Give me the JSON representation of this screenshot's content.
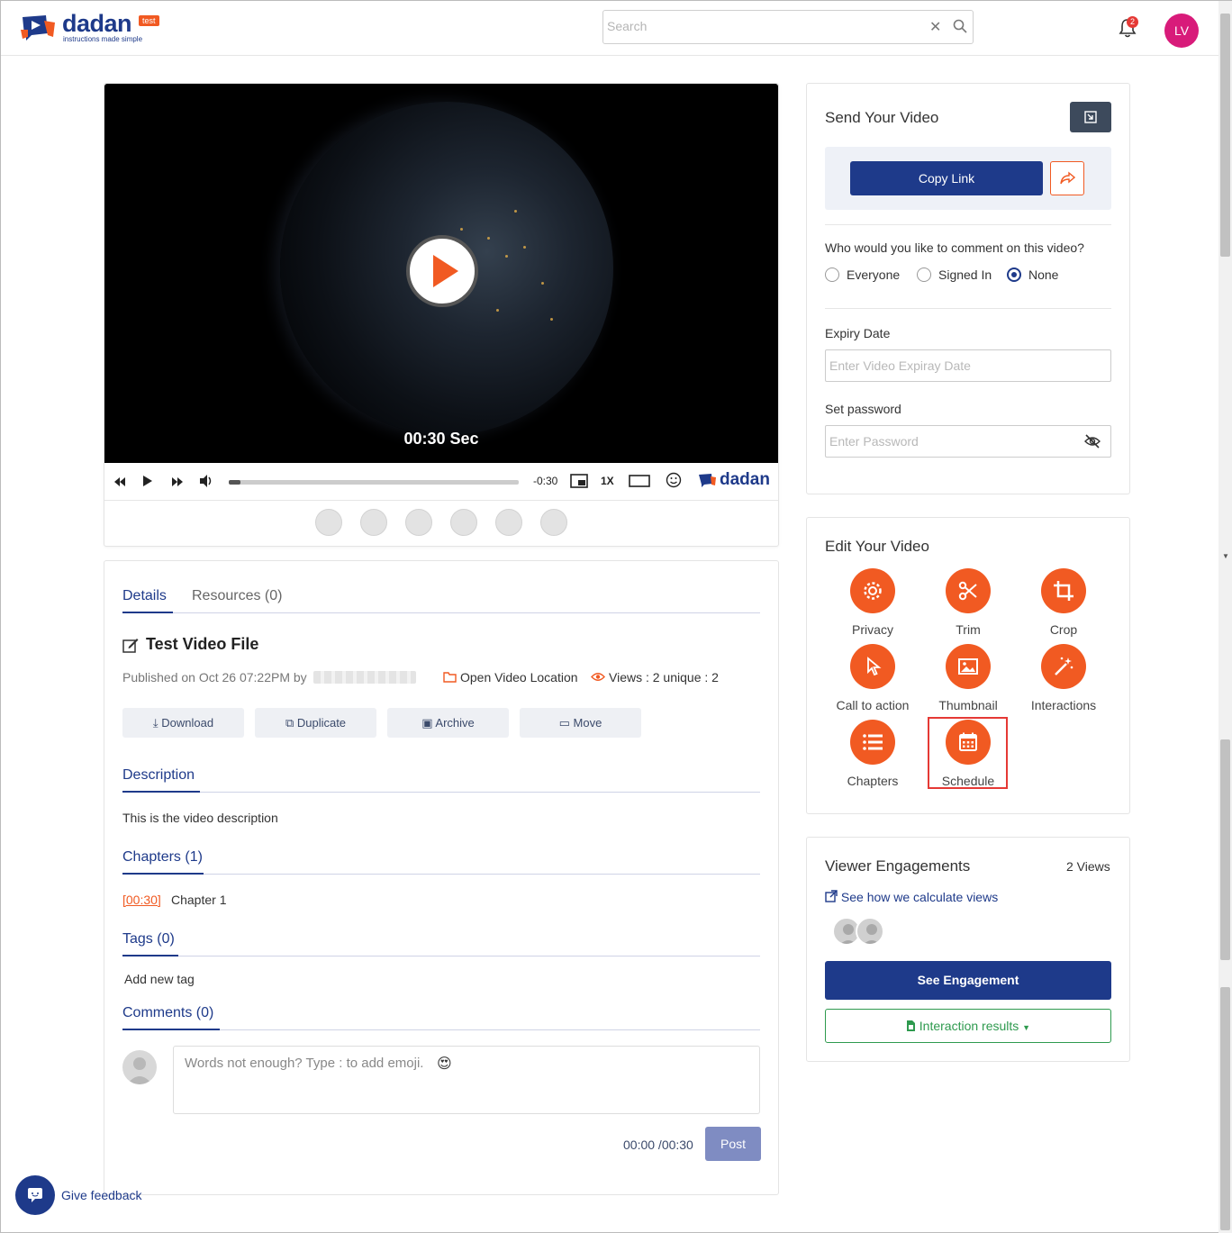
{
  "header": {
    "logo_word": "dadan",
    "logo_badge": "test",
    "logo_tagline": "instructions made simple",
    "search_placeholder": "Search",
    "clear_glyph": "✕",
    "notification_count": "2",
    "user_initials": "LV"
  },
  "player": {
    "overlay_time": "00:30 Sec",
    "remaining": "-0:30",
    "speed": "1X",
    "brand": "dadan",
    "progress_fraction": 0.04
  },
  "details": {
    "tabs": [
      {
        "label": "Details"
      },
      {
        "label": "Resources (0)"
      }
    ],
    "title": "Test Video File",
    "published": "Published on Oct 26 07:22PM by",
    "open_location": "Open Video Location",
    "views": "Views : 2 unique : 2",
    "actions": [
      {
        "label": "Download",
        "icon": "download-icon"
      },
      {
        "label": "Duplicate",
        "icon": "duplicate-icon"
      },
      {
        "label": "Archive",
        "icon": "archive-icon"
      },
      {
        "label": "Move",
        "icon": "folder-icon"
      }
    ],
    "description_heading": "Description",
    "description_text": "This is the video description",
    "chapters_heading": "Chapters (1)",
    "chapter": {
      "time": "[00:30]",
      "name": "Chapter 1"
    },
    "tags_heading": "Tags (0)",
    "add_tag": "Add new tag",
    "comments_heading": "Comments (0)",
    "comment_placeholder": "Words not enough? Type : to add emoji.",
    "comment_time": "00:00 /00:30",
    "post_label": "Post"
  },
  "send": {
    "title": "Send Your Video",
    "copy_link": "Copy Link",
    "comment_question": "Who would you like to comment on this video?",
    "options": [
      {
        "label": "Everyone",
        "selected": false
      },
      {
        "label": "Signed In",
        "selected": false
      },
      {
        "label": "None",
        "selected": true
      }
    ],
    "expiry_label": "Expiry Date",
    "expiry_placeholder": "Enter Video Expiray Date",
    "password_label": "Set password",
    "password_placeholder": "Enter Password"
  },
  "edit": {
    "title": "Edit Your Video",
    "tools": [
      {
        "label": "Privacy",
        "icon": "gear-icon"
      },
      {
        "label": "Trim",
        "icon": "scissors-icon"
      },
      {
        "label": "Crop",
        "icon": "crop-icon"
      },
      {
        "label": "Call to action",
        "icon": "pointer-icon"
      },
      {
        "label": "Thumbnail",
        "icon": "image-icon"
      },
      {
        "label": "Interactions",
        "icon": "magic-wand-icon"
      },
      {
        "label": "Chapters",
        "icon": "list-icon"
      },
      {
        "label": "Schedule",
        "icon": "calendar-icon"
      }
    ]
  },
  "engagement": {
    "title": "Viewer Engagements",
    "count": "2 Views",
    "calc_link": "See how we calculate views",
    "see_button": "See Engagement",
    "interaction_results": "Interaction results"
  },
  "feedback": {
    "label": "Give feedback"
  },
  "colors": {
    "brand": "#1e3a8a",
    "accent": "#f15a22",
    "success": "#2e9a4e",
    "highlight": "#e53935"
  }
}
